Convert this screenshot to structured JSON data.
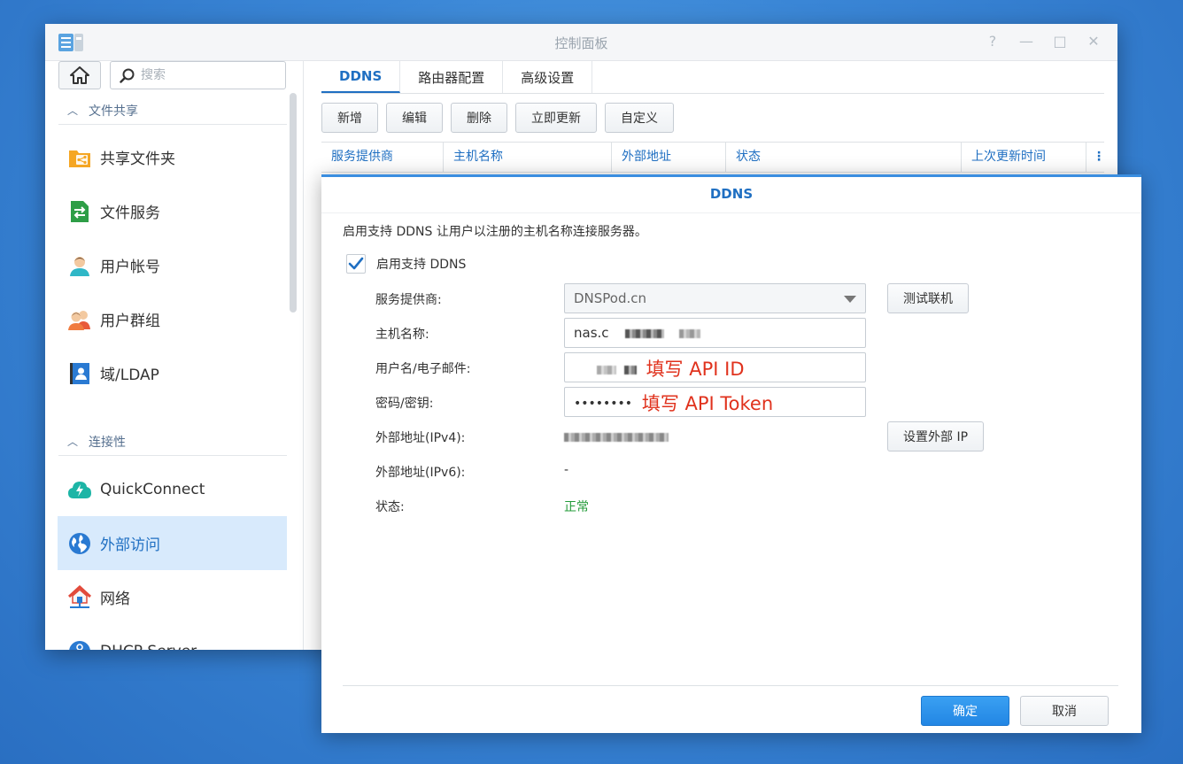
{
  "window": {
    "title": "控制面板",
    "controls": [
      "?",
      "—",
      "□",
      "✕"
    ]
  },
  "sidebar": {
    "search_placeholder": "搜索",
    "sections": [
      {
        "label": "文件共享"
      },
      {
        "label": "连接性"
      }
    ],
    "items": [
      {
        "label": "共享文件夹",
        "icon": "shared-folder-icon"
      },
      {
        "label": "文件服务",
        "icon": "file-services-icon"
      },
      {
        "label": "用户帐号",
        "icon": "user-icon"
      },
      {
        "label": "用户群组",
        "icon": "group-icon"
      },
      {
        "label": "域/LDAP",
        "icon": "domain-ldap-icon"
      },
      {
        "label": "QuickConnect",
        "icon": "quickconnect-icon"
      },
      {
        "label": "外部访问",
        "icon": "external-access-icon",
        "active": true
      },
      {
        "label": "网络",
        "icon": "network-icon"
      },
      {
        "label": "DHCP Server",
        "icon": "dhcp-server-icon"
      }
    ]
  },
  "tabs": [
    {
      "label": "DDNS",
      "active": true
    },
    {
      "label": "路由器配置"
    },
    {
      "label": "高级设置"
    }
  ],
  "toolbar": {
    "add": "新增",
    "edit": "编辑",
    "delete": "删除",
    "update_now": "立即更新",
    "customize": "自定义"
  },
  "grid": {
    "columns": [
      "服务提供商",
      "主机名称",
      "外部地址",
      "状态",
      "上次更新时间"
    ],
    "menu_icon": "more-vertical-icon"
  },
  "dialog": {
    "title": "DDNS",
    "description": "启用支持 DDNS 让用户以注册的主机名称连接服务器。",
    "enable_label": "启用支持 DDNS",
    "enable_checked": true,
    "fields": {
      "provider_label": "服务提供商:",
      "provider_value": "DNSPod.cn",
      "hostname_label": "主机名称:",
      "hostname_value": "nas.c",
      "username_label": "用户名/电子邮件:",
      "username_annotation": "填写 API ID",
      "password_label": "密码/密钥:",
      "password_value": "••••••••",
      "password_annotation": "填写 API Token",
      "ipv4_label": "外部地址(IPv4):",
      "ipv6_label": "外部地址(IPv6):",
      "ipv6_value": "-",
      "status_label": "状态:",
      "status_value": "正常"
    },
    "test_connection": "测试联机",
    "set_external_ip": "设置外部 IP",
    "ok": "确定",
    "cancel": "取消"
  },
  "colors": {
    "accent": "#1f6fc2",
    "annotation": "#e0321d",
    "status_ok": "#239b3a",
    "desktop": "#3a86d6"
  }
}
